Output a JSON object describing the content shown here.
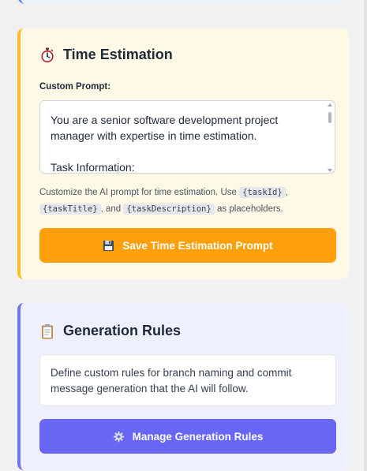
{
  "time_estimation": {
    "title": "Time Estimation",
    "icon": "stopwatch-icon",
    "prompt_label": "Custom Prompt:",
    "prompt_value": "You are a senior software development project manager with expertise in time estimation.\n\nTask Information:",
    "help_text": {
      "prefix": "Customize the AI prompt for time estimation. Use ",
      "tag1": "{taskId}",
      "sep1": ", ",
      "tag2": "{taskTitle}",
      "sep2": ", and ",
      "tag3": "{taskDescription}",
      "suffix": " as placeholders."
    },
    "save_button_label": "Save Time Estimation Prompt",
    "save_button_icon": "floppy-disk-icon"
  },
  "generation_rules": {
    "title": "Generation Rules",
    "icon": "clipboard-icon",
    "description": "Define custom rules for branch naming and commit message generation that the AI will follow.",
    "manage_button_label": "Manage Generation Rules",
    "manage_button_icon": "gear-icon"
  },
  "colors": {
    "time_card_bg": "#fef9e7",
    "time_card_accent": "#fbbf24",
    "save_button": "#ff9f0a",
    "rules_card_bg": "#eef0fd",
    "rules_card_accent": "#6f73f0",
    "rules_button": "#6866f5"
  }
}
